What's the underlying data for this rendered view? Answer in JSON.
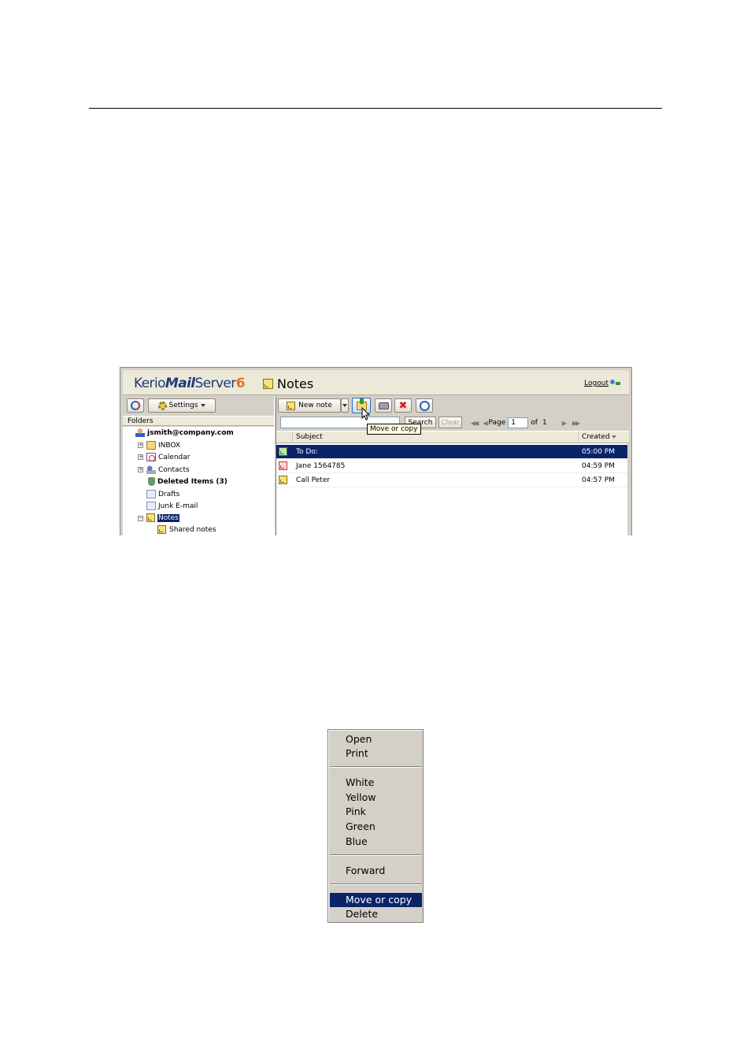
{
  "app": {
    "logo": {
      "part1": "Kerio",
      "part2": "Mail",
      "part3": "Server",
      "part4": "6"
    },
    "folder_title": "Notes",
    "logout_label": "Logout"
  },
  "left_toolbar": {
    "settings_label": "Settings"
  },
  "folders": {
    "header": "Folders",
    "items": [
      {
        "label": "jsmith@company.com",
        "icon": "user-icon"
      },
      {
        "label": "INBOX",
        "icon": "inbox-icon"
      },
      {
        "label": "Calendar",
        "icon": "calendar-icon"
      },
      {
        "label": "Contacts",
        "icon": "contacts-icon"
      },
      {
        "label": "Deleted Items (3)",
        "icon": "trash-icon"
      },
      {
        "label": "Drafts",
        "icon": "drafts-icon"
      },
      {
        "label": "Junk E-mail",
        "icon": "junk-icon"
      },
      {
        "label": "Notes",
        "icon": "notes-icon"
      },
      {
        "label": "Shared notes",
        "icon": "notes-icon"
      }
    ]
  },
  "toolbar": {
    "new_note_label": "New note",
    "tooltip": "Move or copy"
  },
  "search": {
    "value": "",
    "search_label": "Search",
    "clear_label": "Clear",
    "page_label": "Page",
    "page_value": "1",
    "of_label": "of",
    "total_pages": "1"
  },
  "list": {
    "columns": {
      "subject": "Subject",
      "created": "Created"
    },
    "rows": [
      {
        "subject": "To Do:",
        "created": "05:00 PM",
        "color": "green"
      },
      {
        "subject": "Jane 1564785",
        "created": "04:59 PM",
        "color": "pink"
      },
      {
        "subject": "Call Peter",
        "created": "04:57 PM",
        "color": "yellow"
      }
    ]
  },
  "context_menu": {
    "items": [
      "Open",
      "Print",
      "White",
      "Yellow",
      "Pink",
      "Green",
      "Blue",
      "Forward",
      "Move or copy",
      "Delete"
    ],
    "active": "Move or copy"
  },
  "colors": {
    "selection": "#0a246a",
    "chrome": "#d4d0c8",
    "header": "#ece9d8"
  }
}
